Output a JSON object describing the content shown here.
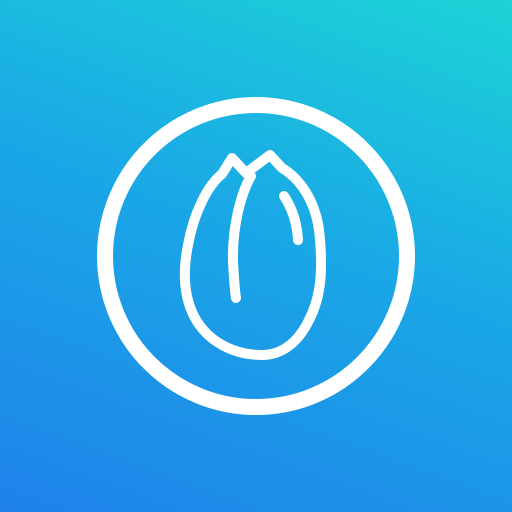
{
  "app_icon": {
    "icon_name": "seed-in-circle-icon",
    "colors": {
      "gradient_top": "#1cd3d6",
      "gradient_middle": "#1aa8e6",
      "gradient_bottom": "#1f82ea",
      "glyph": "#ffffff"
    }
  }
}
